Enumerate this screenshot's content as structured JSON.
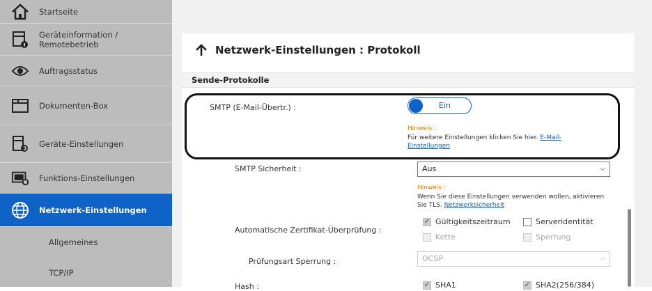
{
  "sidebar": {
    "items": [
      {
        "label": "Startseite",
        "icon": "home-icon"
      },
      {
        "label": "Geräteinformation /\nRemotebetrieb",
        "icon": "device-info-icon"
      },
      {
        "label": "Auftragsstatus",
        "icon": "eye-icon"
      },
      {
        "label": "Dokumenten-Box",
        "icon": "folder-icon"
      },
      {
        "label": "Geräte-Einstellungen",
        "icon": "device-settings-icon"
      },
      {
        "label": "Funktions-Einstellungen",
        "icon": "function-settings-icon"
      },
      {
        "label": "Netzwerk-Einstellungen",
        "icon": "globe-icon"
      }
    ],
    "subitems": [
      "Allgemeines",
      "TCP/IP"
    ],
    "active_color": "#0f62c6"
  },
  "page": {
    "title": "Netzwerk-Einstellungen : Protokoll",
    "section": "Sende-Protokolle",
    "smtp_label": "SMTP (E-Mail-Übertr.) :",
    "toggle_label": "Ein",
    "hint1_title": "Hinweis :",
    "hint1_text": "Für weitere Einstellungen klicken Sie hier.",
    "hint1_link_a": "E-Mail-",
    "hint1_link_b": "Einstellungen",
    "smtp_security_label": "SMTP Sicherheit :",
    "smtp_security_value": "Aus",
    "hint2_title": "Hinweis :",
    "hint2_line1": "Wenn Sie diese Einstellungen verwenden wollen, aktivieren",
    "hint2_line2": "Sie TLS.",
    "hint2_link": "Netzwerksicherheit",
    "cert_label": "Automatische Zertifikat-Überprüfung :",
    "cert_options": [
      {
        "label": "Gültigkeitszeitraum",
        "checked": true
      },
      {
        "label": "Serveridentität",
        "checked": false
      },
      {
        "label": "Kette",
        "checked": false
      },
      {
        "label": "Sperrung",
        "checked": false
      }
    ],
    "revocation_label": "Prüfungsart Sperrung :",
    "revocation_value": "OCSP",
    "hash_label": "Hash :",
    "hash_options": [
      {
        "label": "SHA1",
        "checked": true
      },
      {
        "label": "SHA2(256/384)",
        "checked": true
      }
    ]
  }
}
